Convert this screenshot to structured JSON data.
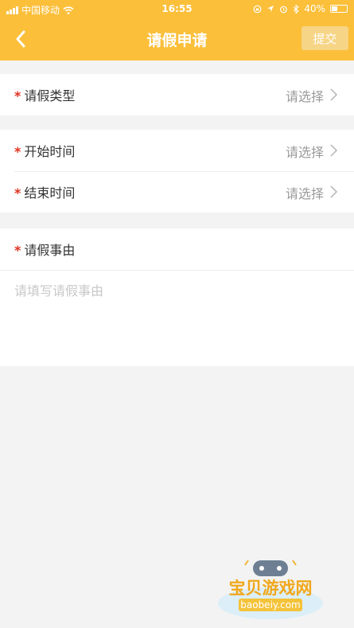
{
  "status_bar": {
    "carrier": "中国移动",
    "time": "16:55",
    "battery": "40%"
  },
  "nav": {
    "title": "请假申请",
    "submit_label": "提交",
    "back_icon": "chevron-left-icon"
  },
  "form": {
    "required_mark": "*",
    "leave_type": {
      "label": "请假类型",
      "value": "请选择"
    },
    "start_time": {
      "label": "开始时间",
      "value": "请选择"
    },
    "end_time": {
      "label": "结束时间",
      "value": "请选择"
    },
    "reason": {
      "label": "请假事由",
      "placeholder": "请填写请假事由"
    }
  },
  "watermark": {
    "brand": "宝贝游戏网",
    "url": "baobeiy.com"
  },
  "colors": {
    "header": "#fbbf3a",
    "required": "#e0311f",
    "submit_disabled": "#f7d586"
  }
}
